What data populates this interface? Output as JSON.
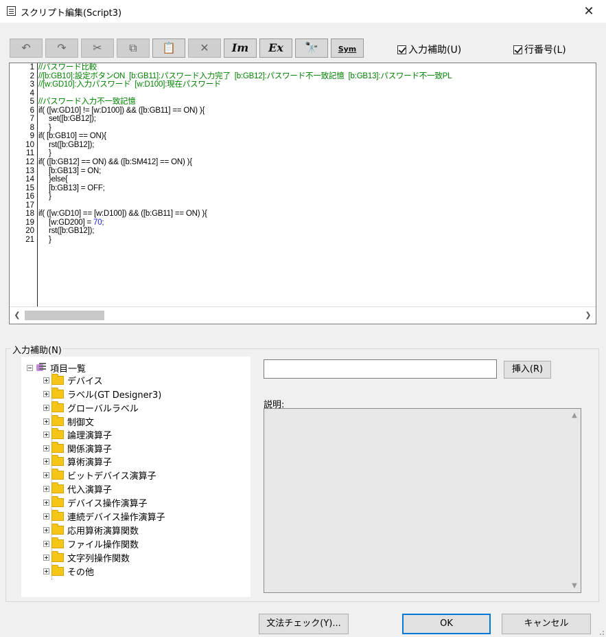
{
  "window": {
    "title": "スクリプト編集(Script3)",
    "close_symbol": "✕"
  },
  "toolbar": {
    "buttons": [
      {
        "name": "undo",
        "glyph": "↶",
        "enabled": false
      },
      {
        "name": "redo",
        "glyph": "↷",
        "enabled": false
      },
      {
        "name": "cut",
        "glyph": "✂",
        "enabled": false
      },
      {
        "name": "copy",
        "glyph": "⧉",
        "enabled": false
      },
      {
        "name": "paste",
        "glyph": "📋",
        "enabled": true
      },
      {
        "name": "delete",
        "glyph": "✕",
        "enabled": false
      },
      {
        "name": "insert-im",
        "glyph": "Im",
        "enabled": true
      },
      {
        "name": "insert-ex",
        "glyph": "Ex",
        "enabled": true
      },
      {
        "name": "find",
        "glyph": "🔭",
        "enabled": true
      },
      {
        "name": "symbol",
        "glyph": "Sym",
        "enabled": true
      }
    ],
    "input_assist_label": "入力補助(U)",
    "line_number_label": "行番号(L)"
  },
  "editor": {
    "line_numbers": [
      "1",
      "2",
      "3",
      "4",
      "5",
      "6",
      "7",
      "8",
      "9",
      "10",
      "11",
      "12",
      "13",
      "14",
      "15",
      "16",
      "17",
      "18",
      "19",
      "20",
      "21"
    ],
    "lines": [
      "//パスワード比較",
      "//[b:GB10]:設定ボタンON  [b:GB11]:パスワード入力完了  [b:GB12]:パスワード不一致記憶  [b:GB13]:パスワード不一致PL",
      "//[w:GD10]:入力パスワード  [w:D100]:現在パスワード",
      "",
      "//パスワード入力不一致記憶",
      "if( ([w:GD10] != [w:D100]) && ([b:GB11] == ON) ){",
      "     set([b:GB12]);",
      "     }",
      "if( [b:GB10] == ON){",
      "     rst([b:GB12]);",
      "     }",
      "if( ([b:GB12] == ON) && ([b:SM412] == ON) ){",
      "     [b:GB13] = ON;",
      "     }else{",
      "     [b:GB13] = OFF;",
      "     }",
      "",
      "if( ([w:GD10] == [w:D100]) && ([b:GB11] == ON) ){",
      "     [w:GD200] = ",
      "     rst([b:GB12]);",
      "     }"
    ],
    "line19_number": "70;"
  },
  "input_assist": {
    "group_label": "入力補助(N)",
    "tree_root": "項目一覧",
    "tree_items": [
      "デバイス",
      "ラベル(GT Designer3)",
      "グローバルラベル",
      "制御文",
      "論理演算子",
      "関係演算子",
      "算術演算子",
      "ビットデバイス演算子",
      "代入演算子",
      "デバイス操作演算子",
      "連続デバイス操作演算子",
      "応用算術演算関数",
      "ファイル操作関数",
      "文字列操作関数",
      "その他"
    ],
    "insert_value": "",
    "insert_button": "挿入(R)",
    "description_label": "説明:"
  },
  "footer": {
    "syntax_check_button": "文法チェック(Y)...",
    "ok_button": "OK",
    "cancel_button": "キャンセル"
  }
}
